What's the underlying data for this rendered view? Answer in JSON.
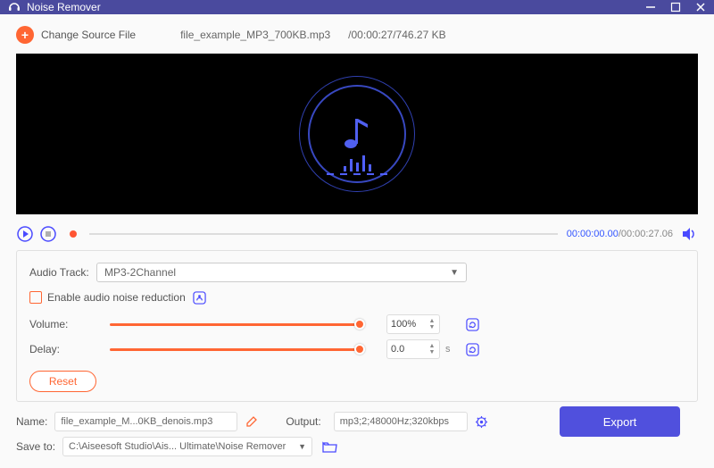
{
  "window": {
    "title": "Noise Remover"
  },
  "source": {
    "change_label": "Change Source File",
    "filename": "file_example_MP3_700KB.mp3",
    "duration": "/00:00:27/746.27 KB"
  },
  "playback": {
    "current_time": "00:00:00.00",
    "total_time": "/00:00:27.06"
  },
  "audiotrack": {
    "label": "Audio Track:",
    "selected": "MP3-2Channel"
  },
  "noise": {
    "label": "Enable audio noise reduction"
  },
  "volume": {
    "label": "Volume:",
    "value": "100%"
  },
  "delay": {
    "label": "Delay:",
    "value": "0.0",
    "unit": "s"
  },
  "reset": {
    "label": "Reset"
  },
  "output": {
    "name_label": "Name:",
    "name_value": "file_example_M...0KB_denois.mp3",
    "output_label": "Output:",
    "output_value": "mp3;2;48000Hz;320kbps",
    "saveto_label": "Save to:",
    "saveto_value": "C:\\Aiseesoft Studio\\Ais... Ultimate\\Noise Remover"
  },
  "export": {
    "label": "Export"
  }
}
